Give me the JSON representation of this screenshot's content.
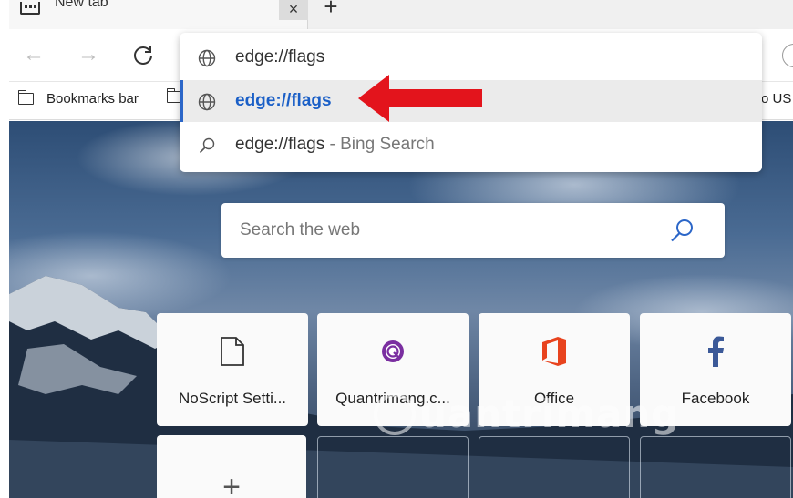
{
  "window": {
    "tab_title": "New tab",
    "tab_close": "×",
    "new_tab": "+"
  },
  "toolbar": {
    "back": "←",
    "forward": "→",
    "reload": "↻"
  },
  "bookmarks": {
    "bar_label": "Bookmarks bar",
    "right_fragment": "o US"
  },
  "omnibox": {
    "input_text": "edge://flags",
    "suggestions": [
      {
        "text": "edge://flags",
        "icon": "globe-icon"
      },
      {
        "text": "edge://flags",
        "suffix": " - Bing Search",
        "icon": "search-icon"
      }
    ]
  },
  "annotation": {
    "arrow_color": "#e3141c",
    "arrow_icon": "red-arrow"
  },
  "newtab": {
    "search_placeholder": "Search the web",
    "tiles": [
      {
        "label": "NoScript Setti...",
        "icon": "document-icon"
      },
      {
        "label": "Quantrimang.c...",
        "icon": "quantrimang-icon"
      },
      {
        "label": "Office",
        "icon": "office-icon"
      },
      {
        "label": "Facebook",
        "icon": "facebook-icon"
      }
    ],
    "add_tile": "+"
  },
  "watermark": {
    "text": "uantrimang"
  },
  "colors": {
    "selected_text": "#1a5fc7",
    "selected_bar": "#2b66c8",
    "office": "#e8431e",
    "facebook": "#3b5998",
    "quantrimang": "#7a2ea0",
    "search_icon": "#2b66c8"
  }
}
